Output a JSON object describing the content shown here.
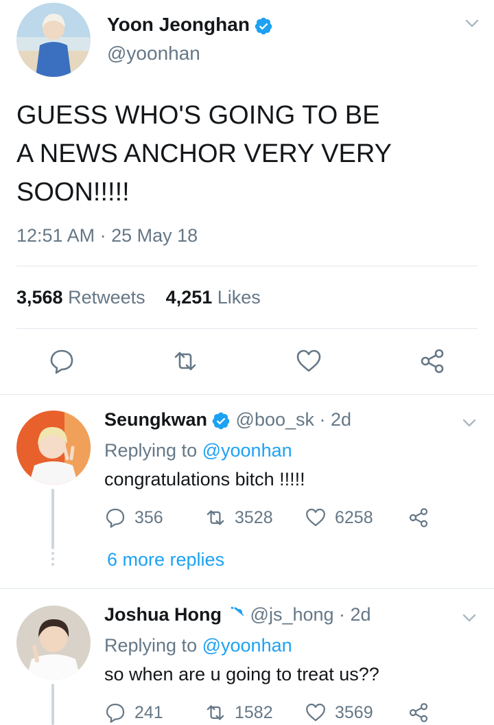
{
  "main_tweet": {
    "author_name": "Yoon Jeonghan",
    "author_handle": "@yoonhan",
    "text_lines": [
      "GUESS WHO'S GOING TO BE",
      "A NEWS ANCHOR VERY VERY",
      "SOON!!!!!"
    ],
    "timestamp": "12:51 AM · 25 May 18",
    "retweets_count": "3,568",
    "retweets_label": "Retweets",
    "likes_count": "4,251",
    "likes_label": "Likes"
  },
  "replies": [
    {
      "author_name": "Seungkwan",
      "author_handle": "@boo_sk",
      "time": "· 2d",
      "replying_prefix": "Replying to",
      "replying_to": "@yoonhan",
      "text": "congratulations bitch !!!!!",
      "reply_count": "356",
      "retweet_count": "3528",
      "like_count": "6258",
      "more_replies": "6 more replies"
    },
    {
      "author_name": "Joshua Hong",
      "author_handle": "@js_hong",
      "time": "· 2d",
      "replying_prefix": "Replying to",
      "replying_to": "@yoonhan",
      "text": "so when are u going to treat us??",
      "reply_count": "241",
      "retweet_count": "1582",
      "like_count": "3569"
    }
  ],
  "colors": {
    "accent": "#1da1f2",
    "muted": "#657786",
    "text": "#14171a",
    "divider": "#e1e8ed"
  },
  "icons": [
    "verified-badge-icon",
    "chevron-down-icon",
    "reply-icon",
    "retweet-icon",
    "like-icon",
    "share-icon"
  ]
}
